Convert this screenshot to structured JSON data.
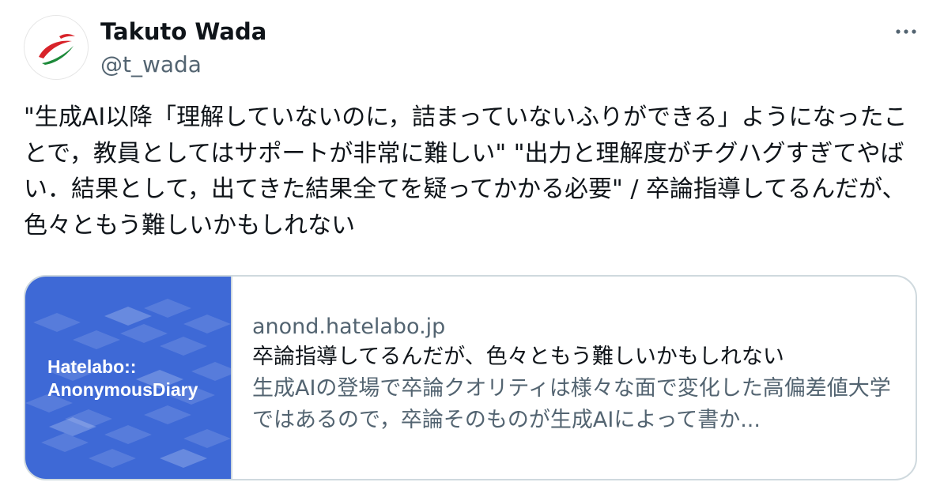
{
  "author": {
    "name": "Takuto Wada",
    "handle": "@t_wada"
  },
  "tweet": {
    "text": "\"生成AI以降「理解していないのに，詰まっていないふりができる」ようになったことで，教員としてはサポートが非常に難しい\" \"出力と理解度がチグハグすぎてやばい．結果として，出てきた結果全てを疑ってかかる必要\" / 卒論指導してるんだが、色々ともう難しいかもしれない"
  },
  "card": {
    "thumb_title": "Hatelabo::\nAnonymousDiary",
    "domain": "anond.hatelabo.jp",
    "title": "卒論指導してるんだが、色々ともう難しいかもしれない",
    "description": "生成AIの登場で卒論クオリティは様々な面で変化した高偏差値大学ではあるので，卒論そのものが生成AIによって書か..."
  },
  "icons": {
    "more": "more-horizontal-icon",
    "avatar_logo": "swoosh-logo"
  },
  "colors": {
    "text": "#0f1419",
    "secondary": "#536471",
    "border": "#cfd9de",
    "thumb_bg": "#3e69d6"
  }
}
